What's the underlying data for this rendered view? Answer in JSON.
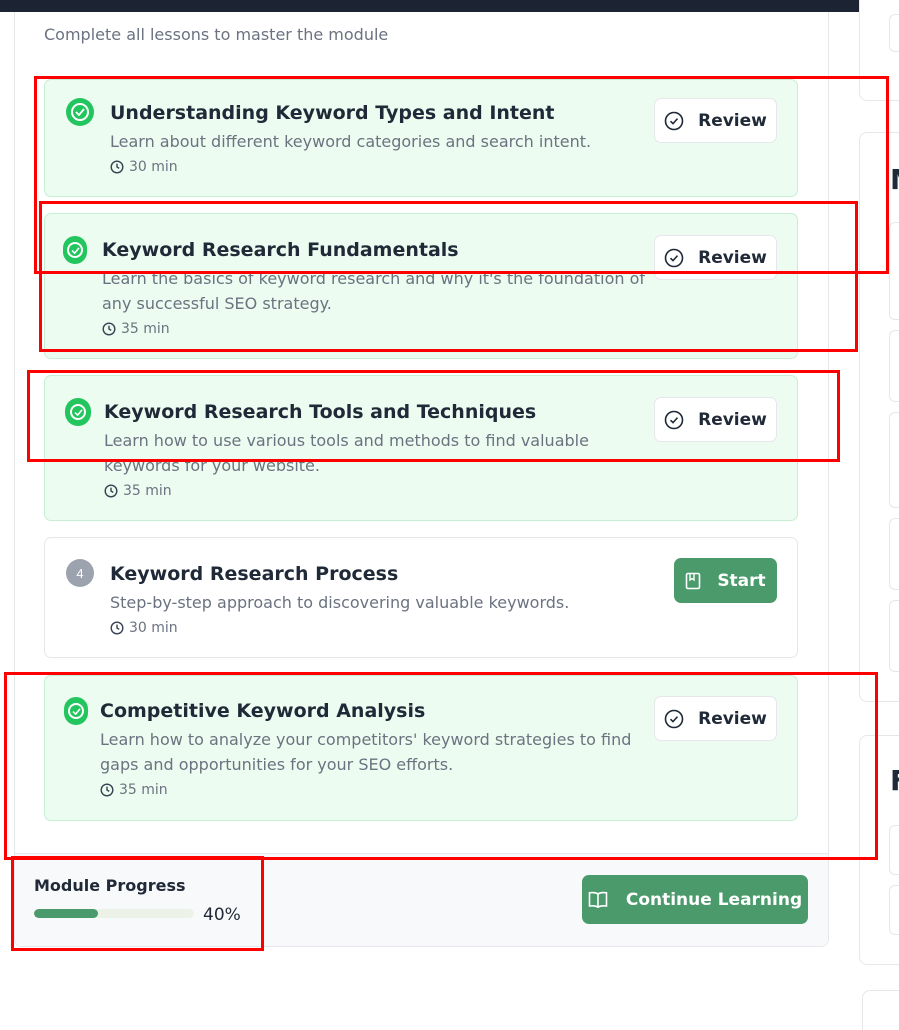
{
  "module": {
    "subtitle": "Complete all lessons to master the module"
  },
  "lessons": [
    {
      "title": "Understanding Keyword Types and Intent",
      "description": "Learn about different keyword categories and search intent.",
      "duration": "30 min",
      "status": "completed",
      "action": "Review"
    },
    {
      "title": "Keyword Research Fundamentals",
      "description": "Learn the basics of keyword research and why it's the foundation of any successful SEO strategy.",
      "duration": "35 min",
      "status": "completed",
      "action": "Review"
    },
    {
      "title": "Keyword Research Tools and Techniques",
      "description": "Learn how to use various tools and methods to find valuable keywords for your website.",
      "duration": "35 min",
      "status": "completed",
      "action": "Review"
    },
    {
      "number": "4",
      "title": "Keyword Research Process",
      "description": "Step-by-step approach to discovering valuable keywords.",
      "duration": "30 min",
      "status": "not-started",
      "action": "Start"
    },
    {
      "title": "Competitive Keyword Analysis",
      "description": "Learn how to analyze your competitors' keyword strategies to find gaps and opportunities for your SEO efforts.",
      "duration": "35 min",
      "status": "completed",
      "action": "Review"
    }
  ],
  "progress": {
    "label": "Module Progress",
    "percent_text": "40%",
    "value": 0.4
  },
  "continue_button": "Continue Learning",
  "sidebar": {
    "card1_letter": "M",
    "card2_letter": "F"
  },
  "colors": {
    "accent": "#4a9a6b",
    "completed_bg": "#edfcf1",
    "check_green": "#22c55e",
    "annotation_red": "#ff0000"
  },
  "icons": [
    "check-circle-icon",
    "clock-icon",
    "book-icon",
    "open-book-icon"
  ]
}
